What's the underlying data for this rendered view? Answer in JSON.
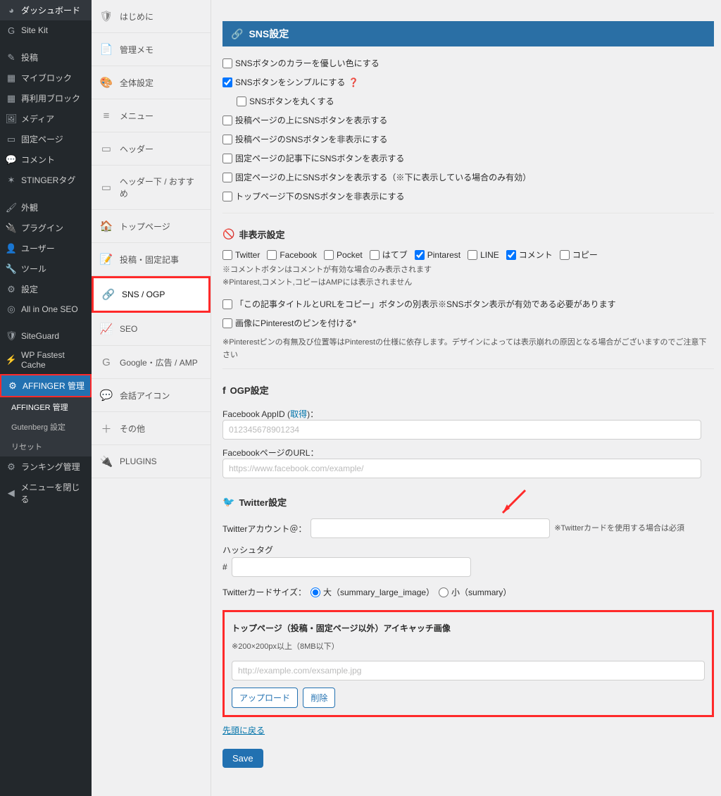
{
  "adminbar": [
    {
      "icon": "◕",
      "label": "ダッシュボード"
    },
    {
      "icon": "G",
      "label": "Site Kit"
    },
    {
      "sep": true
    },
    {
      "icon": "✎",
      "label": "投稿"
    },
    {
      "icon": "▦",
      "label": "マイブロック"
    },
    {
      "icon": "▦",
      "label": "再利用ブロック"
    },
    {
      "icon": "🖼",
      "label": "メディア"
    },
    {
      "icon": "▭",
      "label": "固定ページ"
    },
    {
      "icon": "💬",
      "label": "コメント"
    },
    {
      "icon": "✶",
      "label": "STINGERタグ"
    },
    {
      "sep": true
    },
    {
      "icon": "🖌",
      "label": "外観"
    },
    {
      "icon": "🔌",
      "label": "プラグイン"
    },
    {
      "icon": "👤",
      "label": "ユーザー"
    },
    {
      "icon": "🔧",
      "label": "ツール"
    },
    {
      "icon": "⚙",
      "label": "設定"
    },
    {
      "icon": "◎",
      "label": "All in One SEO"
    },
    {
      "sep": true
    },
    {
      "icon": "🛡",
      "label": "SiteGuard"
    },
    {
      "icon": "⚡",
      "label": "WP Fastest Cache"
    },
    {
      "icon": "⚙",
      "label": "AFFINGER 管理",
      "hl": true
    },
    {
      "sub": true,
      "label": "AFFINGER 管理",
      "current": true
    },
    {
      "sub": true,
      "label": "Gutenberg 設定"
    },
    {
      "sub": true,
      "label": "リセット"
    },
    {
      "icon": "⚙",
      "label": "ランキング管理"
    },
    {
      "icon": "◀",
      "label": "メニューを閉じる"
    }
  ],
  "tabs": [
    {
      "icon": "🛡",
      "label": "はじめに"
    },
    {
      "icon": "📄",
      "label": "管理メモ"
    },
    {
      "icon": "🎨",
      "label": "全体設定"
    },
    {
      "icon": "≡",
      "label": "メニュー"
    },
    {
      "icon": "▭",
      "label": "ヘッダー"
    },
    {
      "icon": "▭",
      "label": "ヘッダー下 / おすすめ"
    },
    {
      "icon": "🏠",
      "label": "トップページ"
    },
    {
      "icon": "📝",
      "label": "投稿・固定記事"
    },
    {
      "icon": "🔗",
      "label": "SNS / OGP",
      "active": true
    },
    {
      "icon": "📈",
      "label": "SEO"
    },
    {
      "icon": "G",
      "label": "Google・広告 / AMP"
    },
    {
      "icon": "💬",
      "label": "会話アイコン"
    },
    {
      "icon": "＋",
      "label": "その他"
    },
    {
      "icon": "🔌",
      "label": "PLUGINS"
    }
  ],
  "panel": {
    "title": "SNS設定",
    "checks": [
      {
        "label": "SNSボタンのカラーを優しい色にする"
      },
      {
        "label": "SNSボタンをシンプルにする",
        "checked": true,
        "help": true
      },
      {
        "label": "SNSボタンを丸くする",
        "indent": true
      },
      {
        "label": "投稿ページの上にSNSボタンを表示する"
      },
      {
        "label": "投稿ページのSNSボタンを非表示にする"
      },
      {
        "label": "固定ページの記事下にSNSボタンを表示する"
      },
      {
        "label": "固定ページの上にSNSボタンを表示する（※下に表示している場合のみ有効）"
      },
      {
        "label": "トップページ下のSNSボタンを非表示にする"
      }
    ],
    "hidden_title": "非表示設定",
    "hidden_checks": [
      {
        "label": "Twitter"
      },
      {
        "label": "Facebook"
      },
      {
        "label": "Pocket"
      },
      {
        "label": "はてブ"
      },
      {
        "label": "Pintarest",
        "checked": true
      },
      {
        "label": "LINE"
      },
      {
        "label": "コメント",
        "checked": true
      },
      {
        "label": "コピー"
      }
    ],
    "hidden_note1": "※コメントボタンはコメントが有効な場合のみ表示されます",
    "hidden_note2": "※Pintarest,コメント,コピーはAMPには表示されません",
    "extra_checks": [
      {
        "label": "「この記事タイトルとURLをコピー」ボタンの別表示※SNSボタン表示が有効である必要があります"
      },
      {
        "label": "画像にPinterestのピンを付ける*"
      }
    ],
    "pinterest_note": "※Pinterestピンの有無及び位置等はPinterestの仕様に依存します。デザインによっては表示崩れの原因となる場合がございますのでご注意下さい",
    "ogp_title": "OGP設定",
    "fb_app_label": "Facebook AppID (",
    "fb_app_link": "取得",
    "fb_app_label_after": ")：",
    "fb_app_placeholder": "012345678901234",
    "fb_url_label": "FacebookページのURL：",
    "fb_url_placeholder": "https://www.facebook.com/example/",
    "tw_heading": "Twitter設定",
    "tw_account_label": "Twitterアカウント＠：",
    "tw_account_note": "※Twitterカードを使用する場合は必須",
    "tw_hash_label": "ハッシュタグ",
    "tw_hash_prefix": "#",
    "tw_card_label": "Twitterカードサイズ：",
    "tw_card_large": "大（summary_large_image）",
    "tw_card_small": "小（summary）",
    "eyecatch_title": "トップページ（投稿・固定ページ以外）アイキャッチ画像",
    "eyecatch_note": "※200×200px以上（8MB以下）",
    "eyecatch_placeholder": "http://example.com/exsample.jpg",
    "upload_btn": "アップロード",
    "delete_btn": "削除",
    "back_link": "先頭に戻る",
    "save": "Save"
  }
}
